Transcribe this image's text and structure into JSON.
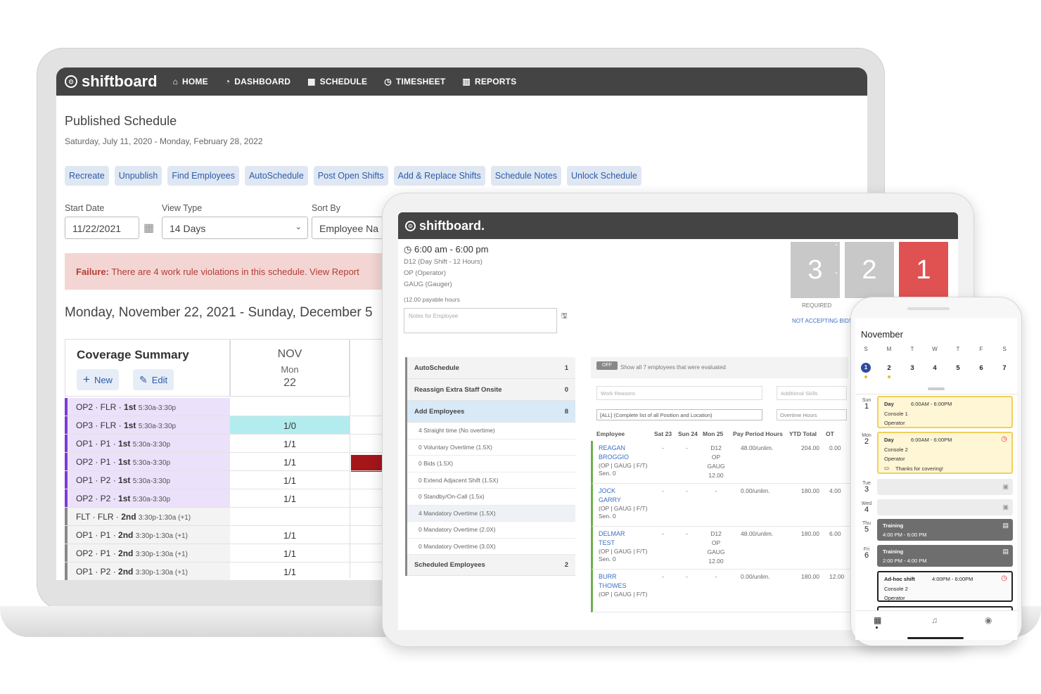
{
  "laptop": {
    "brand": "shiftboard",
    "nav": [
      {
        "icon": "home-icon",
        "label": "HOME"
      },
      {
        "icon": "dashboard-icon",
        "label": "DASHBOARD"
      },
      {
        "icon": "calendar-icon",
        "label": "SCHEDULE"
      },
      {
        "icon": "clock-icon",
        "label": "TIMESHEET"
      },
      {
        "icon": "bar-chart-icon",
        "label": "REPORTS"
      }
    ],
    "page_title": "Published Schedule",
    "date_range": "Saturday, July 11, 2020 - Monday, February 28, 2022",
    "actions": [
      "Recreate",
      "Unpublish",
      "Find Employees",
      "AutoSchedule",
      "Post Open Shifts",
      "Add & Replace Shifts",
      "Schedule Notes",
      "Unlock Schedule"
    ],
    "start_date": {
      "label": "Start Date",
      "value": "11/22/2021"
    },
    "view_type": {
      "label": "View Type",
      "value": "14 Days"
    },
    "sort_by": {
      "label": "Sort By",
      "value": "Employee Na"
    },
    "alert": {
      "prefix": "Failure:",
      "text": "There are 4 work rule violations in this schedule. View Report"
    },
    "week_title": "Monday, November 22, 2021  -  Sunday, December 5",
    "coverage": {
      "title": "Coverage Summary",
      "new_label": "New",
      "edit_label": "Edit",
      "day": {
        "month": "NOV",
        "weekday": "Mon",
        "date": "22"
      },
      "rows": [
        {
          "label": "OP2 · FLR · ",
          "shift": "1st",
          "time": "5:30a-3:30p",
          "value": "",
          "kind": "purple"
        },
        {
          "label": "OP3 · FLR · ",
          "shift": "1st",
          "time": "5:30a-3:30p",
          "value": "1/0",
          "kind": "purple",
          "highlight": "#b3ecee"
        },
        {
          "label": "OP1 · P1 · ",
          "shift": "1st",
          "time": "5:30a-3:30p",
          "value": "1/1",
          "kind": "purple"
        },
        {
          "label": "OP2 · P1 · ",
          "shift": "1st",
          "time": "5:30a-3:30p",
          "value": "1/1",
          "kind": "purple"
        },
        {
          "label": "OP1 · P2 · ",
          "shift": "1st",
          "time": "5:30a-3:30p",
          "value": "1/1",
          "kind": "purple"
        },
        {
          "label": "OP2 · P2 · ",
          "shift": "1st",
          "time": "5:30a-3:30p",
          "value": "1/1",
          "kind": "purple"
        },
        {
          "label": "FLT · FLR · ",
          "shift": "2nd",
          "time": "3:30p-1:30a (+1)",
          "value": "",
          "kind": "grey"
        },
        {
          "label": "OP1 · P1 · ",
          "shift": "2nd",
          "time": "3:30p-1:30a (+1)",
          "value": "1/1",
          "kind": "grey"
        },
        {
          "label": "OP2 · P1 · ",
          "shift": "2nd",
          "time": "3:30p-1:30a (+1)",
          "value": "1/1",
          "kind": "grey"
        },
        {
          "label": "OP1 · P2 · ",
          "shift": "2nd",
          "time": "3:30p-1:30a (+1)",
          "value": "1/1",
          "kind": "grey"
        }
      ]
    }
  },
  "tablet": {
    "brand": "shiftboard.",
    "shift_time": "6:00 am - 6:00 pm",
    "details": [
      "D12 (Day Shift - 12 Hours)",
      "OP (Operator)",
      "GAUG (Gauger)"
    ],
    "payable": "(12.00 payable hours",
    "notes_placeholder": "Notes for Employee",
    "counts": [
      {
        "value": "3",
        "label": "REQUIRED",
        "color": "#c8c8c8"
      },
      {
        "value": "2",
        "label": "",
        "color": "#c8c8c8"
      },
      {
        "value": "1",
        "label": "",
        "color": "#e05252"
      }
    ],
    "not_accepting": "NOT ACCEPTING BIDS",
    "left_panel": [
      {
        "label": "AutoSchedule",
        "count": "1"
      },
      {
        "label": "Reassign Extra Staff Onsite",
        "count": "0"
      },
      {
        "label": "Add Employees",
        "count": "8"
      }
    ],
    "sub_items": [
      "4 Straight time (No overtime)",
      "0 Voluntary Overtime (1.5X)",
      "0 Bids (1.5X)",
      "0 Extend Adjacent Shift (1.5X)",
      "0 Standby/On-Call (1.5x)",
      "4 Mandatory Overtime (1.5X)",
      "0 Mandatory Overtime (2.0X)",
      "0 Mandatory Overtime (3.0X)"
    ],
    "scheduled": {
      "label": "Scheduled Employees",
      "count": "2"
    },
    "toggle": "OFF",
    "show_all": "Show all 7 employees that were evaluated",
    "work_reasons": "Work Reasons",
    "additional_skills": "Additional Skills",
    "filter": "[ALL] (Complete list of all Position and Location)",
    "overtime_hours": "Overtime Hours",
    "columns": [
      "Employee",
      "Sat 23",
      "Sun 24",
      "Mon 25",
      "Pay Period Hours",
      "YTD Total",
      "OT"
    ],
    "employees": [
      {
        "first": "REAGAN",
        "last": "BROGGIO",
        "tags": "(OP | GAUG | F/T)",
        "sen": "Sen. 0",
        "sat": "-",
        "sun": "-",
        "mon": [
          "D12",
          "OP",
          "GAUG",
          "12.00"
        ],
        "pay": "48.00/unlim.",
        "ytd": "204.00",
        "ot": "0.00"
      },
      {
        "first": "JOCK",
        "last": "GARRY",
        "tags": "(OP | GAUG | F/T)",
        "sen": "Sen. 0",
        "sat": "-",
        "sun": "-",
        "mon": [
          "-"
        ],
        "pay": "0.00/unlim.",
        "ytd": "180.00",
        "ot": "4.00"
      },
      {
        "first": "DELMAR",
        "last": "TEST",
        "tags": "(OP | GAUG | F/T)",
        "sen": "Sen. 0",
        "sat": "-",
        "sun": "-",
        "mon": [
          "D12",
          "OP",
          "GAUG",
          "12.00"
        ],
        "pay": "48.00/unlim.",
        "ytd": "180.00",
        "ot": "6.00"
      },
      {
        "first": "BURR",
        "last": "THOWES",
        "tags": "(OP | GAUG | F/T)",
        "sen": "",
        "sat": "-",
        "sun": "-",
        "mon": [
          "-"
        ],
        "pay": "0.00/unlim.",
        "ytd": "180.00",
        "ot": "12.00"
      }
    ]
  },
  "phone": {
    "month": "November",
    "weekdays": [
      "S",
      "M",
      "T",
      "W",
      "T",
      "F",
      "S"
    ],
    "dates": [
      "1",
      "2",
      "3",
      "4",
      "5",
      "6",
      "7"
    ],
    "days": [
      {
        "wd": "Sun",
        "d": "1"
      },
      {
        "wd": "Mon",
        "d": "2"
      },
      {
        "wd": "Tue",
        "d": "3"
      },
      {
        "wd": "Wed",
        "d": "4"
      },
      {
        "wd": "Thu",
        "d": "5"
      },
      {
        "wd": "Fri",
        "d": "6"
      }
    ],
    "shifts": [
      {
        "title": "Day",
        "time": "6:00AM - 6:00PM",
        "line1": "Console 1",
        "line2": "Operator"
      },
      {
        "title": "Day",
        "time": "6:00AM - 6:00PM",
        "line1": "Console 2",
        "line2": "Operator",
        "note": "Thanks for covering!"
      },
      {
        "title": "Training",
        "time": "4:00 PM - 6:00 PM"
      },
      {
        "title": "Training",
        "time": "2:00 PM - 4:00 PM"
      },
      {
        "title": "Ad-hoc shift",
        "time": "4:00PM - 6:00PM",
        "line1": "Console 2",
        "line2": "Operator"
      }
    ]
  }
}
